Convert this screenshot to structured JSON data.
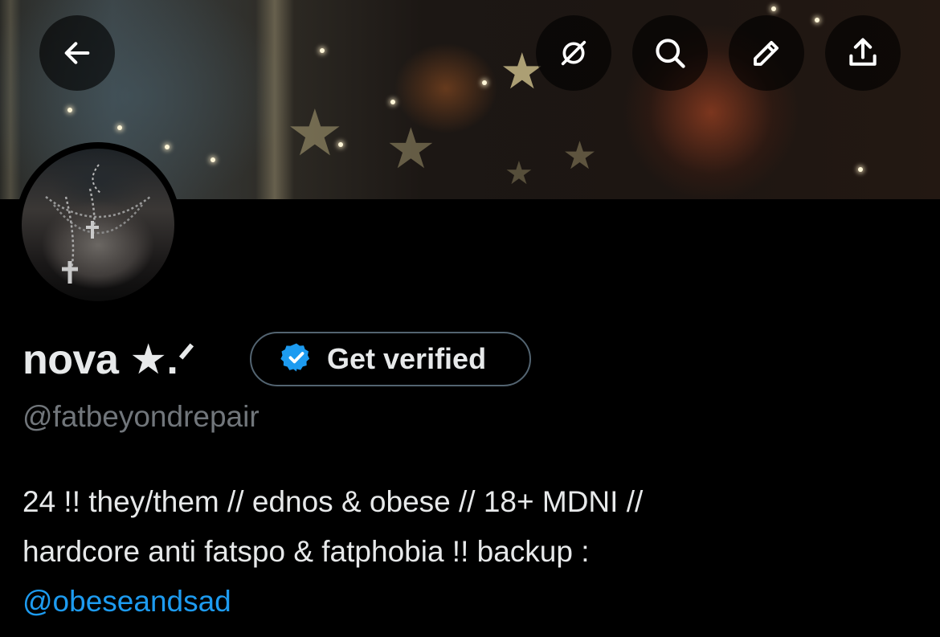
{
  "header": {
    "back_icon": "arrow-left-icon",
    "actions": [
      {
        "name": "grok-icon"
      },
      {
        "name": "search-icon"
      },
      {
        "name": "edit-icon"
      },
      {
        "name": "share-icon"
      }
    ]
  },
  "profile": {
    "display_name": "nova ★.ᐟ",
    "verify_button_label": "Get verified",
    "handle": "@fatbeyondrepair",
    "bio_line1": "24 !! they/them // ednos & obese // 18+ MDNI //",
    "bio_line2": "hardcore anti fatspo & fatphobia !! backup :",
    "bio_mention": "@obeseandsad"
  },
  "colors": {
    "background": "#000000",
    "text": "#e7e9ea",
    "muted": "#71767b",
    "link": "#1d9bf0",
    "verify_badge": "#1d9bf0",
    "button_border": "#536471"
  }
}
